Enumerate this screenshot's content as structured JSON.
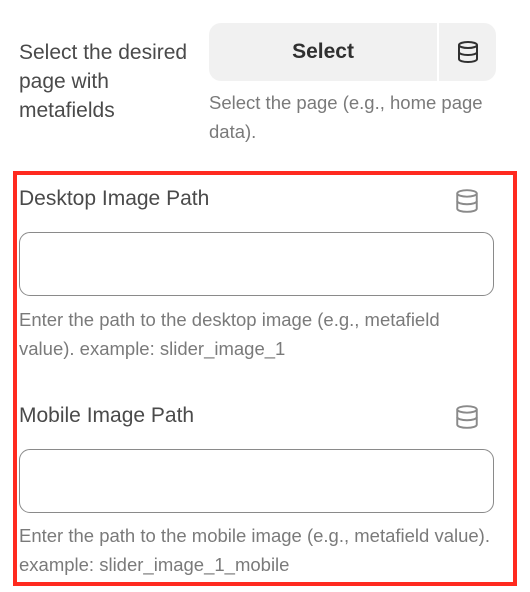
{
  "page_selector": {
    "label": "Select the desired page with metafields",
    "select_button": "Select",
    "db_icon": "database-icon",
    "help": "Select the page (e.g., home page data)."
  },
  "desktop_field": {
    "label": "Desktop Image Path",
    "value": "",
    "placeholder": "",
    "db_icon": "database-icon",
    "help": "Enter the path to the desktop image (e.g., metafield value). example: slider_image_1"
  },
  "mobile_field": {
    "label": "Mobile Image Path",
    "value": "",
    "placeholder": "",
    "db_icon": "database-icon",
    "help": "Enter the path to the mobile image (e.g., metafield value). example: slider_image_1_mobile"
  },
  "colors": {
    "highlight_border": "#ff2a1f",
    "select_bg": "#f1f1f1",
    "help_text": "#7a7a7a"
  }
}
